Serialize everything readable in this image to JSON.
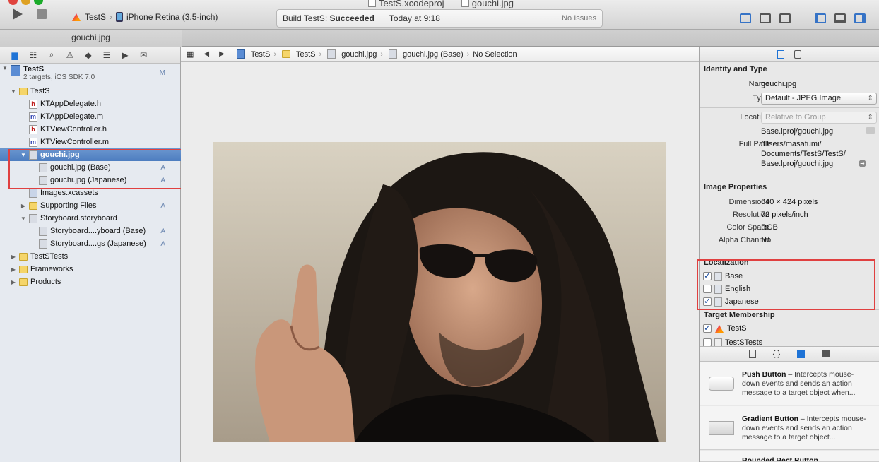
{
  "window": {
    "title_project": "TestS.xcodeproj",
    "title_separator": "—",
    "title_file": "gouchi.jpg",
    "tab_label": "gouchi.jpg"
  },
  "toolbar": {
    "scheme": "TestS",
    "destination": "iPhone Retina (3.5-inch)",
    "activity_prefix": "Build TestS:",
    "activity_status": "Succeeded",
    "activity_time": "Today at 9:18",
    "issues": "No Issues"
  },
  "navigator": {
    "project_name": "TestS",
    "project_subtitle": "2 targets, iOS SDK 7.0",
    "project_badge": "M",
    "items": [
      {
        "label": "TestS",
        "kind": "folder",
        "badge": ""
      },
      {
        "label": "KTAppDelegate.h",
        "kind": "h",
        "badge": ""
      },
      {
        "label": "KTAppDelegate.m",
        "kind": "m",
        "badge": ""
      },
      {
        "label": "KTViewController.h",
        "kind": "h",
        "badge": ""
      },
      {
        "label": "KTViewController.m",
        "kind": "m",
        "badge": ""
      },
      {
        "label": "gouchi.jpg",
        "kind": "img",
        "badge": ""
      },
      {
        "label": "gouchi.jpg (Base)",
        "kind": "img",
        "badge": "A"
      },
      {
        "label": "gouchi.jpg (Japanese)",
        "kind": "img",
        "badge": "A"
      },
      {
        "label": "Images.xcassets",
        "kind": "assets",
        "badge": ""
      },
      {
        "label": "Supporting Files",
        "kind": "folder",
        "badge": "A"
      },
      {
        "label": "Storyboard.storyboard",
        "kind": "img",
        "badge": ""
      },
      {
        "label": "Storyboard....yboard (Base)",
        "kind": "img",
        "badge": "A"
      },
      {
        "label": "Storyboard....gs (Japanese)",
        "kind": "img",
        "badge": "A"
      },
      {
        "label": "TestSTests",
        "kind": "folder",
        "badge": ""
      },
      {
        "label": "Frameworks",
        "kind": "folder",
        "badge": ""
      },
      {
        "label": "Products",
        "kind": "folder",
        "badge": ""
      }
    ]
  },
  "jumpbar": {
    "crumbs": [
      "TestS",
      "TestS",
      "gouchi.jpg",
      "gouchi.jpg (Base)",
      "No Selection"
    ]
  },
  "inspector": {
    "identity_title": "Identity and Type",
    "name_label": "Name",
    "name_value": "gouchi.jpg",
    "type_label": "Type",
    "type_value": "Default - JPEG Image",
    "location_label": "Location",
    "location_value": "Relative to Group",
    "location_path": "Base.lproj/gouchi.jpg",
    "fullpath_label": "Full Path",
    "fullpath_line1": "/Users/masafumi/",
    "fullpath_line2": "Documents/TestS/TestS/",
    "fullpath_line3": "Base.lproj/gouchi.jpg",
    "image_props_title": "Image Properties",
    "dimensions_label": "Dimensions",
    "dimensions_value": "640 × 424 pixels",
    "resolution_label": "Resolution",
    "resolution_value": "72 pixels/inch",
    "colorspace_label": "Color Space",
    "colorspace_value": "RGB",
    "alpha_label": "Alpha Channel",
    "alpha_value": "No",
    "localization_title": "Localization",
    "localizations": [
      {
        "label": "Base",
        "checked": true
      },
      {
        "label": "English",
        "checked": false
      },
      {
        "label": "Japanese",
        "checked": true
      }
    ],
    "target_title": "Target Membership",
    "targets": [
      {
        "label": "TestS",
        "checked": true
      },
      {
        "label": "TestSTests",
        "checked": false
      }
    ]
  },
  "library": {
    "tab_code": "{ }",
    "items": [
      {
        "title": "Push Button",
        "desc": " – Intercepts mouse-down events and sends an action message to a target object when..."
      },
      {
        "title": "Gradient Button",
        "desc": " – Intercepts mouse-down events and sends an action message to a target object..."
      },
      {
        "title": "Rounded Rect Button",
        "desc": ""
      }
    ]
  }
}
